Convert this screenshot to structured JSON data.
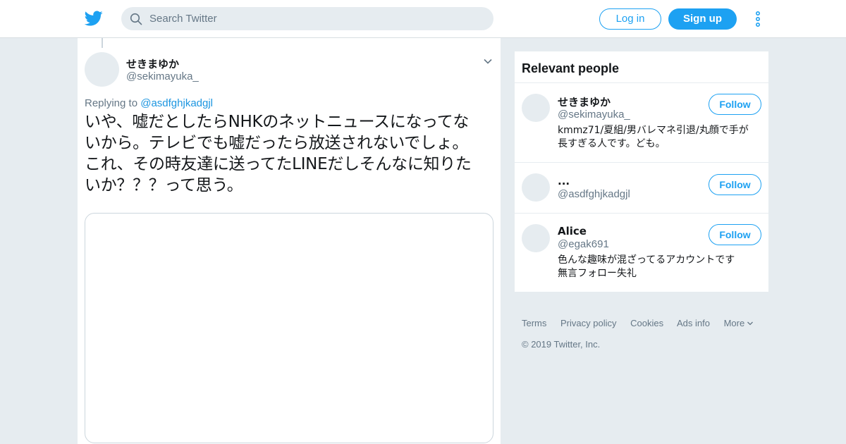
{
  "header": {
    "search_placeholder": "Search Twitter",
    "login_label": "Log in",
    "signup_label": "Sign up",
    "logo_icon": "twitter-bird-icon",
    "brand_color": "#1da1f2"
  },
  "tweet": {
    "author_name": "せきまゆか",
    "author_handle": "@sekimayuka_",
    "replying_prefix": "Replying to ",
    "replying_to": "@asdfghjkadgjl",
    "text": "いや、嘘だとしたらNHKのネットニュースになってな\nいから。テレビでも嘘だったら放送されないでしょ。\nこれ、その時友達に送ってたLINEだしそんなに知りた\nいか？？？って思う。"
  },
  "sidebar": {
    "title": "Relevant people",
    "people": [
      {
        "name": "せきまゆか",
        "handle": "@sekimayuka_",
        "bio": "kmmz71/夏組/男バレマネ引退/丸顔で手が\n長すぎる人です。ども。",
        "follow_label": "Follow"
      },
      {
        "name": "...",
        "handle": "@asdfghjkadgjl",
        "bio": "",
        "follow_label": "Follow"
      },
      {
        "name": "Alice",
        "handle": "@egak691",
        "bio": "色んな趣味が混ざってるアカウントです\n無言フォロー失礼",
        "follow_label": "Follow"
      }
    ]
  },
  "footer": {
    "links": [
      "Terms",
      "Privacy policy",
      "Cookies",
      "Ads info",
      "More"
    ],
    "copyright": "© 2019 Twitter, Inc."
  }
}
